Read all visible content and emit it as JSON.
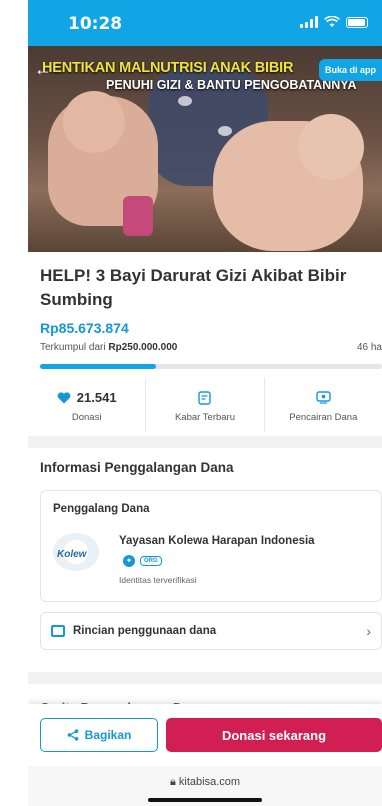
{
  "status_bar": {
    "time": "10:28"
  },
  "hero": {
    "headline": "HENTIKAN MALNUTRISI ANAK BIBIR",
    "subline": "PENUHI GIZI & BANTU PENGOBATANNYA",
    "open_app_label": "Buka di app"
  },
  "campaign": {
    "title": "HELP! 3 Bayi Darurat Gizi Akibat Bibir Sumbing",
    "amount": "Rp85.673.874",
    "collected_prefix": "Terkumpul dari",
    "target": "Rp250.000.000",
    "days_left": "46 ha",
    "progress_fraction": 0.34
  },
  "stats": [
    {
      "value": "21.541",
      "label": "Donasi",
      "icon": "heart-icon"
    },
    {
      "value": "",
      "label": "Kabar Terbaru",
      "icon": "news-icon"
    },
    {
      "value": "",
      "label": "Pencairan Dana",
      "icon": "withdraw-icon"
    }
  ],
  "info": {
    "section_title": "Informasi Penggalangan Dana",
    "card_title": "Penggalang Dana",
    "logo_text": "Kolew",
    "org_name": "Yayasan Kolewa Harapan Indonesia",
    "org_tag": "ORG",
    "verified_text": "Identitas terverifikasi",
    "fund_usage_label": "Rincian penggunaan dana"
  },
  "peek_text": "Cerita Penggalangan Dana",
  "bottom": {
    "share_label": "Bagikan",
    "donate_label": "Donasi sekarang"
  },
  "browser": {
    "url": "kitabisa.com"
  },
  "colors": {
    "primary": "#12a5e6",
    "donate": "#d11f53",
    "headline_yellow": "#f2e33a"
  }
}
